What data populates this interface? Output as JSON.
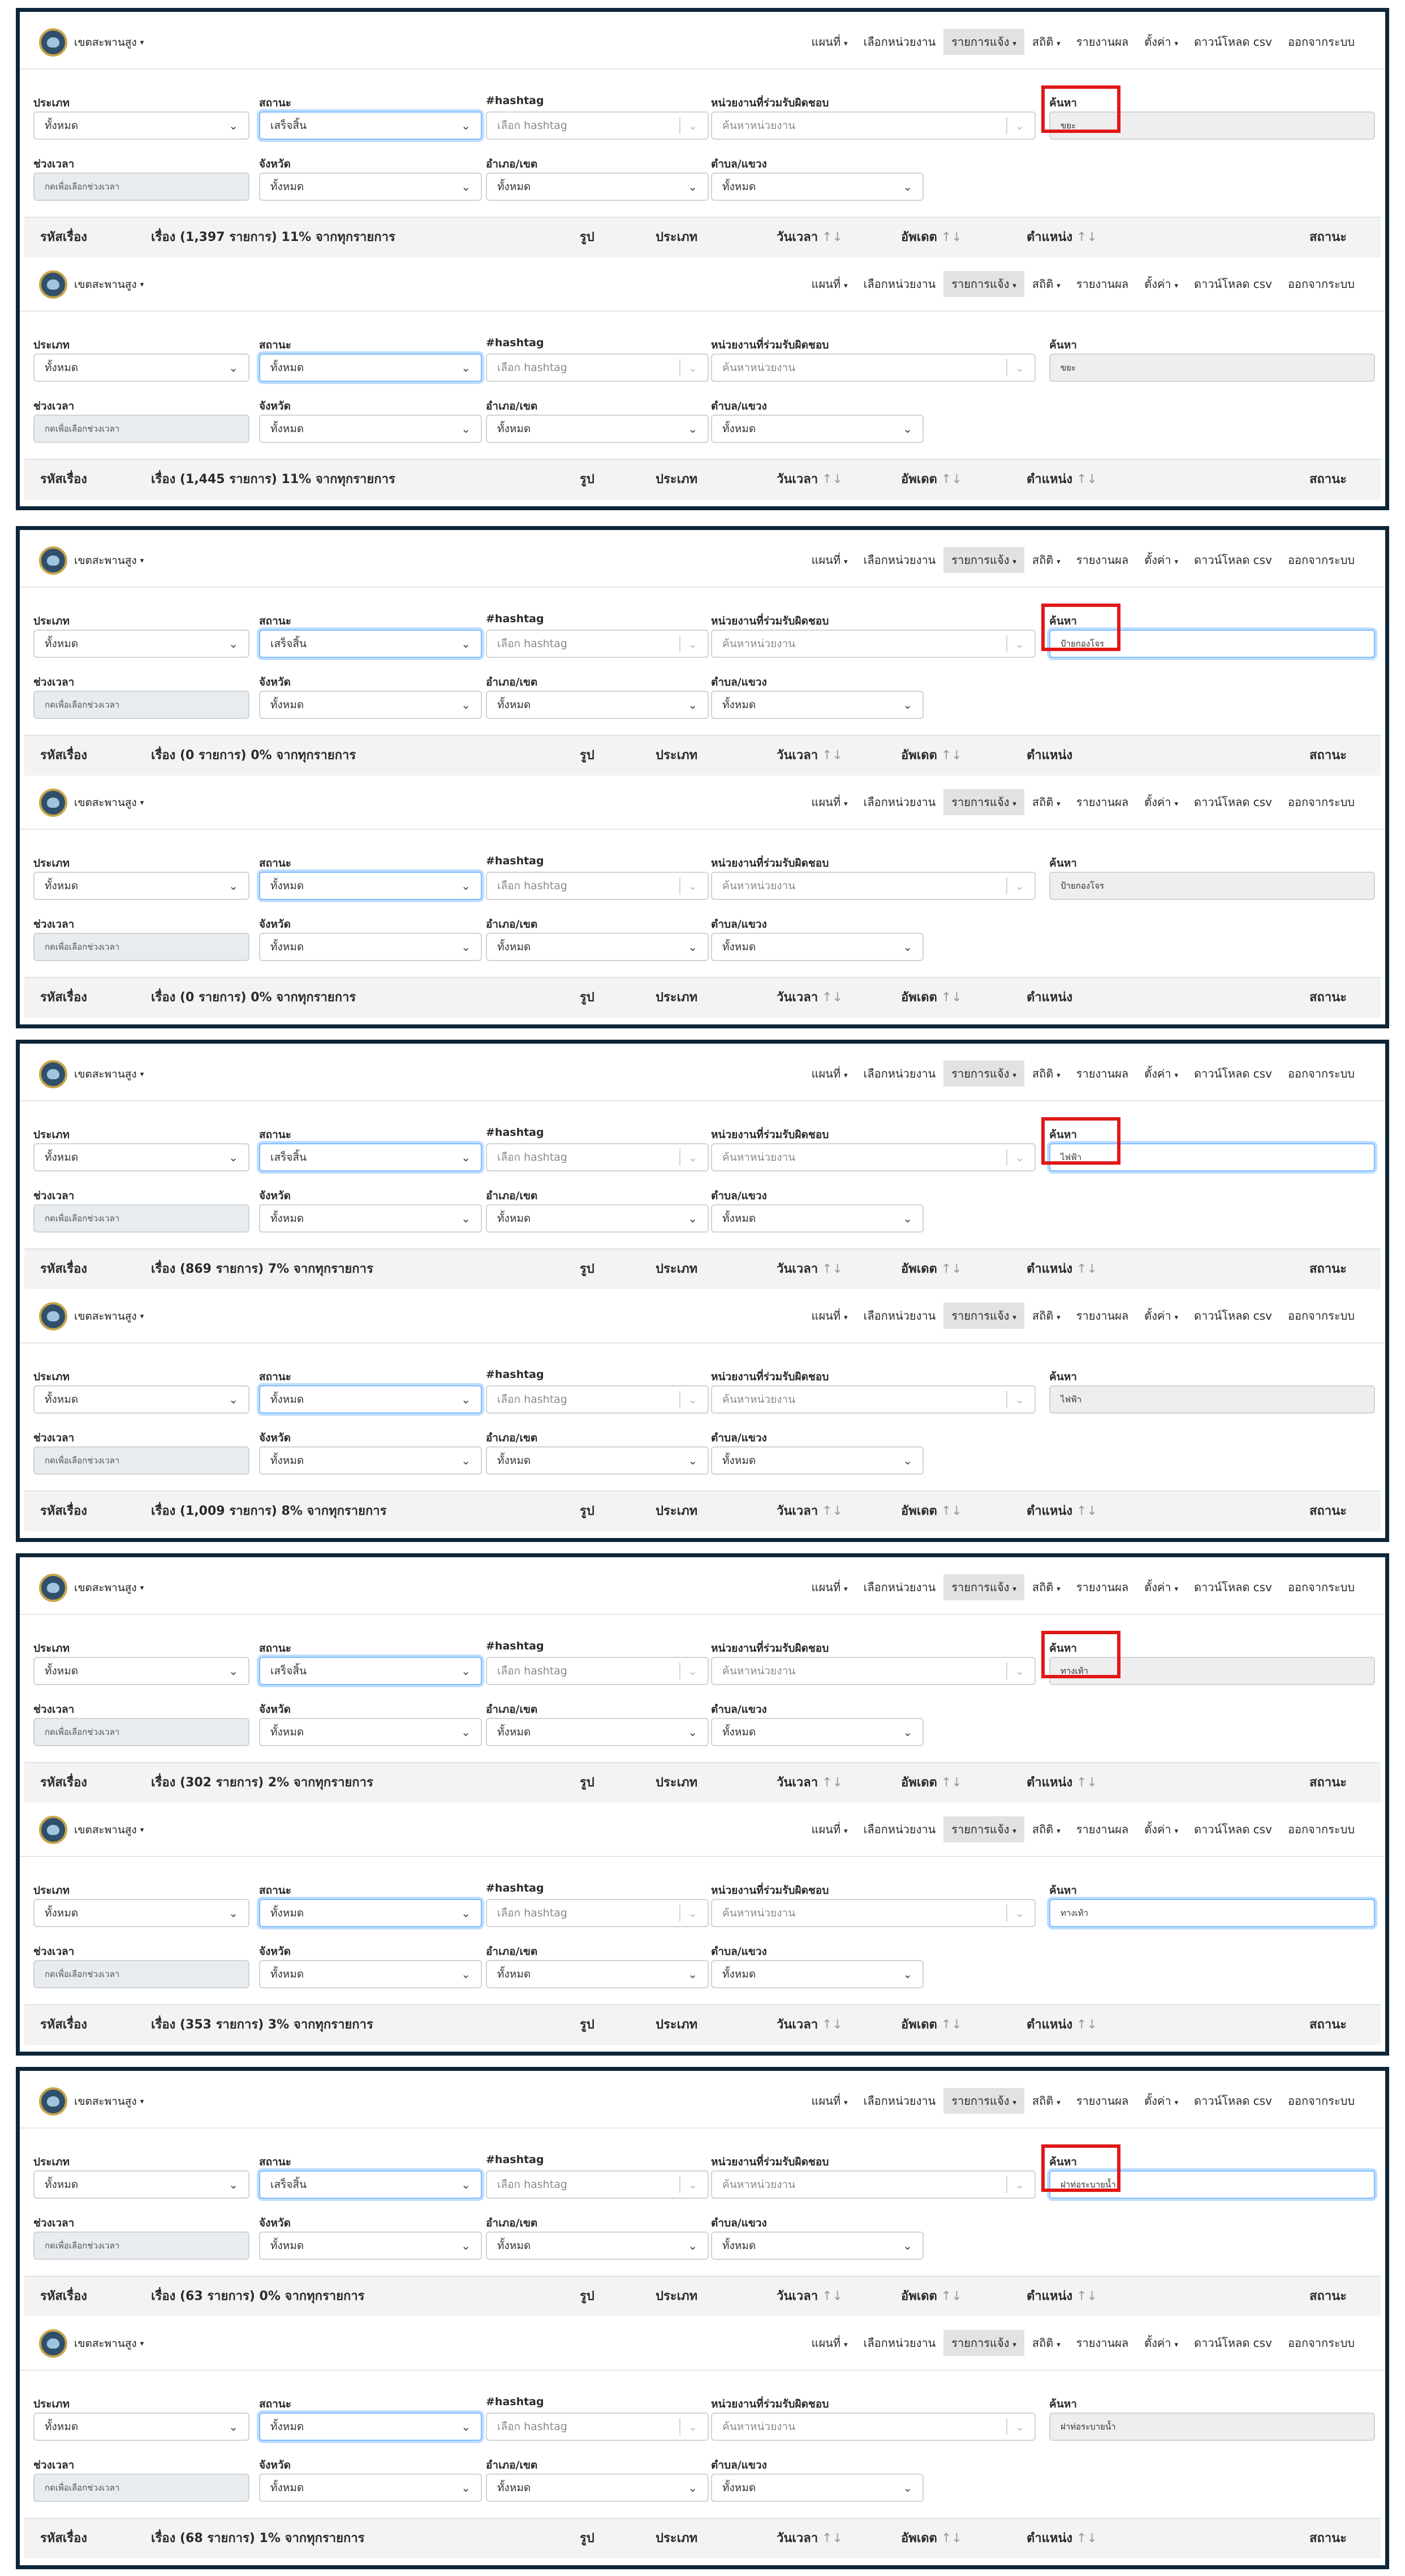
{
  "brand": "เขตสะพานสูง",
  "menu": [
    "แผนที่",
    "เลือกหน่วยงาน",
    "รายการแจ้ง",
    "สถิติ",
    "รายงานผล",
    "ตั้งค่า",
    "ดาวน์โหลด csv",
    "ออกจากระบบ"
  ],
  "filter_labels": {
    "type": "ประเภท",
    "status": "สถานะ",
    "hashtag": "#hashtag",
    "agency": "หน่วยงานที่ร่วมรับผิดชอบ",
    "search": "ค้นหา",
    "period": "ช่วงเวลา",
    "province": "จังหวัด",
    "district": "อำเภอ/เขต",
    "subdistrict": "ตำบล/แขวง"
  },
  "placeholders": {
    "hashtag": "เลือก hashtag",
    "agency": "ค้นหาหน่วยงาน",
    "period": "กดเพื่อเลือกช่วงเวลา"
  },
  "all_option": "ทั้งหมด",
  "table_headers": {
    "id": "รหัสเรื่อง",
    "image": "รูป",
    "type": "ประเภท",
    "date": "วันเวลา",
    "updated": "อัพเดต",
    "location": "ตำแหน่ง",
    "status": "สถานะ"
  },
  "panels": [
    {
      "status": "เสร็จสิ้น",
      "search": "ขยะ",
      "summary": "เรื่อง (1,397 รายการ) 11% จากทุกรายการ"
    },
    {
      "status": "ทั้งหมด",
      "search": "ขยะ",
      "summary": "เรื่อง (1,445 รายการ) 11% จากทุกรายการ"
    },
    {
      "status": "เสร็จสิ้น",
      "search": "ป้ายกองโจร",
      "summary": "เรื่อง (0 รายการ) 0% จากทุกรายการ"
    },
    {
      "status": "ทั้งหมด",
      "search": "ป้ายกองโจร",
      "summary": "เรื่อง (0 รายการ) 0% จากทุกรายการ"
    },
    {
      "status": "เสร็จสิ้น",
      "search": "ไฟฟ้า",
      "summary": "เรื่อง (869 รายการ) 7% จากทุกรายการ"
    },
    {
      "status": "ทั้งหมด",
      "search": "ไฟฟ้า",
      "summary": "เรื่อง (1,009 รายการ) 8% จากทุกรายการ"
    },
    {
      "status": "เสร็จสิ้น",
      "search": "ทางเท้า",
      "summary": "เรื่อง (302 รายการ) 2% จากทุกรายการ"
    },
    {
      "status": "ทั้งหมด",
      "search": "ทางเท้า",
      "summary": "เรื่อง (353 รายการ) 3% จากทุกรายการ"
    },
    {
      "status": "เสร็จสิ้น",
      "search": "ฝาท่อระบายน้ำ",
      "summary": "เรื่อง (63 รายการ) 0% จากทุกรายการ"
    },
    {
      "status": "ทั้งหมด",
      "search": "ฝาท่อระบายน้ำ",
      "summary": "เรื่อง (68 รายการ) 1% จากทุกรายการ"
    }
  ]
}
